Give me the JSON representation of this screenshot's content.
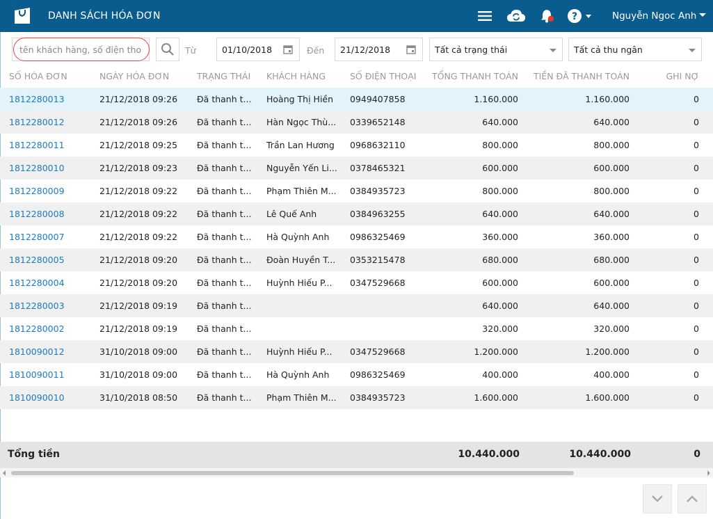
{
  "header": {
    "title": "DANH SÁCH HÓA ĐƠN",
    "user_name": "Nguyễn Ngoc Anh",
    "icons": [
      "shopping-bag-icon",
      "menu-icon",
      "cloud-sync-icon",
      "bell-icon",
      "help-icon"
    ],
    "colors": {
      "bar": "#0b5c8e",
      "notification_dot": "#e53935"
    }
  },
  "filters": {
    "search_placeholder": "tên khách hàng, số điện thoại",
    "from_label": "Từ",
    "from_date": "01/10/2018",
    "to_label": "Đến",
    "to_date": "21/12/2018",
    "status_select": "Tất cả trạng thái",
    "cashier_select": "Tất cả thu ngân"
  },
  "table": {
    "columns": [
      "SỐ HÓA ĐƠN",
      "NGÀY HÓA ĐƠN",
      "TRẠNG THÁI",
      "KHÁCH HÀNG",
      "SỐ ĐIỆN THOẠI",
      "TỔNG THANH TOÁN",
      "TIỀN ĐÃ THANH TOÁN",
      "GHI NỢ"
    ],
    "rows": [
      {
        "id": "1812280013",
        "date": "21/12/2018 09:26",
        "status": "Đã thanh t...",
        "customer": "Hoàng Thị Hiền",
        "phone": "0949407858",
        "total": "1.160.000",
        "paid": "1.160.000",
        "debt": "0"
      },
      {
        "id": "1812280012",
        "date": "21/12/2018 09:26",
        "status": "Đã thanh t...",
        "customer": "Hàn Ngọc Thù...",
        "phone": "0339652148",
        "total": "640.000",
        "paid": "640.000",
        "debt": "0"
      },
      {
        "id": "1812280011",
        "date": "21/12/2018 09:25",
        "status": "Đã thanh t...",
        "customer": "Trần Lan Hương",
        "phone": "0968632110",
        "total": "800.000",
        "paid": "800.000",
        "debt": "0"
      },
      {
        "id": "1812280010",
        "date": "21/12/2018 09:23",
        "status": "Đã thanh t...",
        "customer": "Nguyễn Yến Li...",
        "phone": "0378465321",
        "total": "600.000",
        "paid": "600.000",
        "debt": "0"
      },
      {
        "id": "1812280009",
        "date": "21/12/2018 09:22",
        "status": "Đã thanh t...",
        "customer": "Phạm Thiên M...",
        "phone": "0384935723",
        "total": "800.000",
        "paid": "800.000",
        "debt": "0"
      },
      {
        "id": "1812280008",
        "date": "21/12/2018 09:22",
        "status": "Đã thanh t...",
        "customer": "Lê Quế Anh",
        "phone": "0384963255",
        "total": "640.000",
        "paid": "640.000",
        "debt": "0"
      },
      {
        "id": "1812280007",
        "date": "21/12/2018 09:22",
        "status": "Đã thanh t...",
        "customer": "Hà Quỳnh Anh",
        "phone": "0986325469",
        "total": "360.000",
        "paid": "360.000",
        "debt": "0"
      },
      {
        "id": "1812280005",
        "date": "21/12/2018 09:20",
        "status": "Đã thanh t...",
        "customer": "Đoàn Huyền T...",
        "phone": "0353215478",
        "total": "680.000",
        "paid": "680.000",
        "debt": "0"
      },
      {
        "id": "1812280004",
        "date": "21/12/2018 09:20",
        "status": "Đã thanh t...",
        "customer": "Huỳnh Hiếu P...",
        "phone": "0347529668",
        "total": "600.000",
        "paid": "600.000",
        "debt": "0"
      },
      {
        "id": "1812280003",
        "date": "21/12/2018 09:19",
        "status": "Đã thanh t...",
        "customer": "",
        "phone": "",
        "total": "640.000",
        "paid": "640.000",
        "debt": "0"
      },
      {
        "id": "1812280002",
        "date": "21/12/2018 09:19",
        "status": "Đã thanh t...",
        "customer": "",
        "phone": "",
        "total": "320.000",
        "paid": "320.000",
        "debt": "0"
      },
      {
        "id": "1810090012",
        "date": "31/10/2018 09:00",
        "status": "Đã thanh t...",
        "customer": "Huỳnh Hiếu P...",
        "phone": "0347529668",
        "total": "1.200.000",
        "paid": "1.200.000",
        "debt": "0"
      },
      {
        "id": "1810090011",
        "date": "31/10/2018 09:00",
        "status": "Đã thanh t...",
        "customer": "Hà Quỳnh Anh",
        "phone": "0986325469",
        "total": "400.000",
        "paid": "400.000",
        "debt": "0"
      },
      {
        "id": "1810090010",
        "date": "31/10/2018 08:50",
        "status": "Đã thanh t...",
        "customer": "Phạm Thiên M...",
        "phone": "0384935723",
        "total": "1.600.000",
        "paid": "1.600.000",
        "debt": "0"
      }
    ],
    "footer": {
      "label": "Tổng tiền",
      "total": "10.440.000",
      "paid": "10.440.000",
      "debt": "0"
    }
  }
}
